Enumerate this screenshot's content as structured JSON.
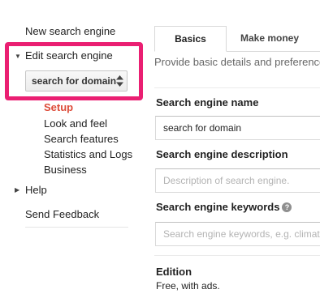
{
  "sidebar": {
    "new_engine": "New search engine",
    "edit_engine": "Edit search engine",
    "engine_select_value": "search for domain",
    "sub_items": [
      "Setup",
      "Look and feel",
      "Search features",
      "Statistics and Logs",
      "Business"
    ],
    "help": "Help",
    "send_feedback": "Send Feedback"
  },
  "tabs": {
    "basics": "Basics",
    "make_money": "Make money"
  },
  "main": {
    "description": "Provide basic details and preferences",
    "name_label": "Search engine name",
    "name_value": "search for domain",
    "desc_label": "Search engine description",
    "desc_placeholder": "Description of search engine.",
    "keywords_label": "Search engine keywords",
    "keywords_help": "?",
    "keywords_placeholder": "Search engine keywords, e.g. climate",
    "edition_label": "Edition",
    "edition_value": "Free, with ads."
  },
  "colors": {
    "highlight": "#ea1f72",
    "active_item": "#dd4b39"
  },
  "icons": {
    "expanded": "caret-down-icon",
    "collapsed": "caret-right-icon",
    "select_arrows": "updown-arrows-icon",
    "help": "help-icon"
  }
}
